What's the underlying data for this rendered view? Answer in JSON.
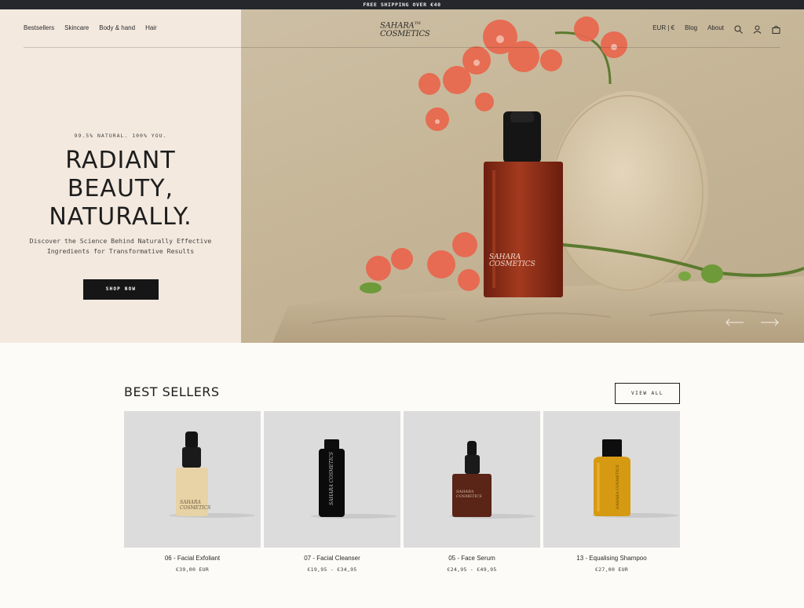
{
  "announcement": "FREE SHIPPING OVER €40",
  "nav": {
    "links": [
      "Bestsellers",
      "Skincare",
      "Body & hand",
      "Hair"
    ],
    "logo_line1": "SAHARA",
    "logo_tm": "TM",
    "logo_line2": "COSMETICS",
    "currency": "EUR | €",
    "blog": "Blog",
    "about": "About"
  },
  "hero": {
    "tagline": "99.5% NATURAL. 100% YOU.",
    "headline": [
      "RADIANT",
      "BEAUTY,",
      "NATURALLY."
    ],
    "subcopy": [
      "Discover the Science Behind Naturally Effective",
      "Ingredients for Transformative Results"
    ],
    "cta": "SHOP NOW",
    "bottle_label_1": "SAHARA",
    "bottle_label_2": "COSMETICS"
  },
  "bestsellers": {
    "title": "BEST SELLERS",
    "view_all": "VIEW ALL",
    "products": [
      {
        "name": "06 - Facial Exfoliant",
        "price": "€39,00 EUR",
        "bottle": "dropper-cream"
      },
      {
        "name": "07 - Facial Cleanser",
        "price": "€19,95 - €34,95",
        "bottle": "black-tall"
      },
      {
        "name": "05 - Face Serum",
        "price": "€24,95 - €49,95",
        "bottle": "dropper-amber"
      },
      {
        "name": "13 - Equalising Shampoo",
        "price": "€27,00 EUR",
        "bottle": "gold-bottle"
      }
    ]
  },
  "colors": {
    "hero_left_bg": "#f3e9df",
    "topbar_bg": "#26272c",
    "button_bg": "#161616",
    "card_bg": "#dcdcdc",
    "orchid": "#e8684f",
    "bottle_amber": "#8a2e1a"
  },
  "icons": [
    "search-icon",
    "user-icon",
    "bag-icon",
    "arrow-left-icon",
    "arrow-right-icon"
  ]
}
